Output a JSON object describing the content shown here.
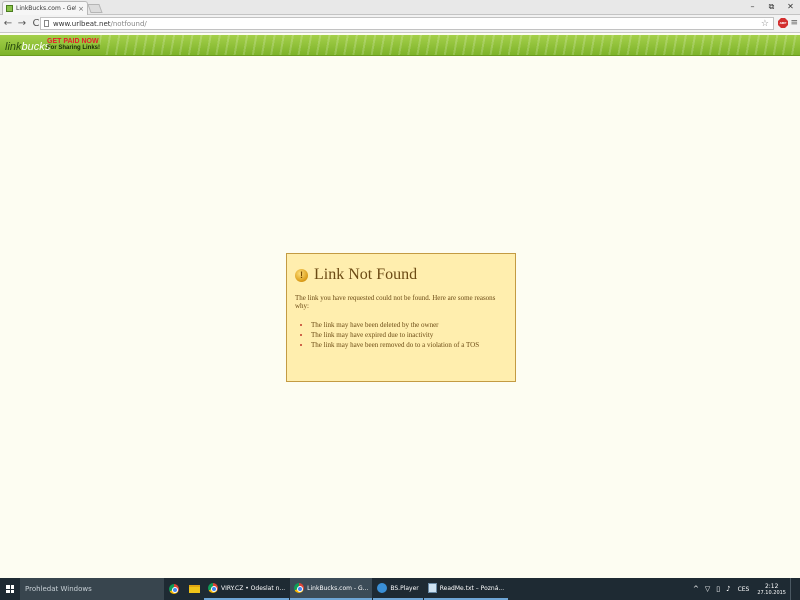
{
  "browser": {
    "tab_title": "LinkBucks.com - Get your",
    "tab_close": "×",
    "url_host": "www.urlbeat.net",
    "url_path": "/notfound/",
    "win_minimize": "–",
    "win_restore": "⧉",
    "win_close": "✕",
    "nav_back": "←",
    "nav_forward": "→",
    "nav_reload": "C",
    "star": "☆",
    "abp": "ABP",
    "menu": "≡"
  },
  "linkbucks_bar": {
    "logo_link": "link",
    "logo_bucks": "bucks",
    "slogan_line1": "GET PAID NOW",
    "slogan_line2": "For Sharing Links!"
  },
  "error": {
    "icon_glyph": "!",
    "title": "Link Not Found",
    "intro": "The link you have requested could not be found. Here are some reasons why:",
    "reasons": [
      "The link may have been deleted by the owner",
      "The link may have expired due to inactivity",
      "The link may have been removed do to a violation of a TOS"
    ]
  },
  "taskbar": {
    "search_placeholder": "Prohledat Windows",
    "tasks": [
      {
        "label": "VIRY.CZ • Odeslat n..."
      },
      {
        "label": "LinkBucks.com - G..."
      },
      {
        "label": "BS.Player"
      },
      {
        "label": "ReadMe.txt – Pozná..."
      }
    ],
    "tray_chevron": "^",
    "tray_lang": "CES",
    "clock_time": "2:12",
    "clock_date": "27.10.2015"
  }
}
